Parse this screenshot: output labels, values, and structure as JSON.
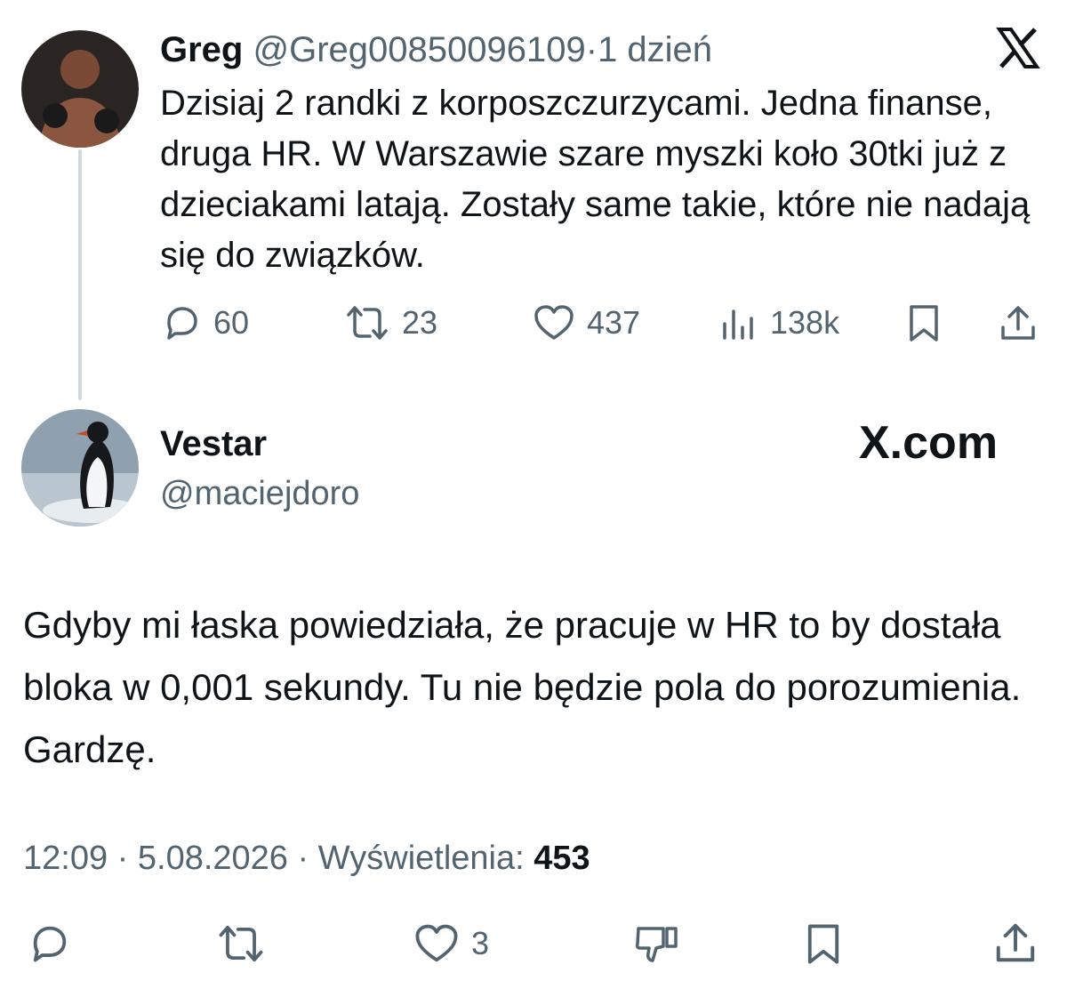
{
  "original_tweet": {
    "name": "Greg",
    "handle": "@Greg00850096109",
    "separator": "·",
    "time": "1 dzień",
    "text": "Dzisiaj 2 randki z korposzczurzycami. Jedna finanse, druga HR. W Warszawie szare myszki koło 30tki już z dzieciakami latają. Zostały same takie, które nie nadają się do związków.",
    "actions": {
      "replies": "60",
      "reposts": "23",
      "likes": "437",
      "views": "138k"
    }
  },
  "watermark": "X.com",
  "reply_tweet": {
    "name": "Vestar",
    "handle": "@maciejdoro",
    "text": "Gdyby mi łaska powiedziała, że pracuje w HR to by dostała bloka w 0,001 sekundy. Tu nie będzie pola do porozumienia. Gardzę.",
    "time": "12:09",
    "date": "5.08.2026",
    "views_label": "Wyświetlenia:",
    "views_count": "453",
    "actions": {
      "likes": "3"
    }
  },
  "icons": [
    "x-logo-icon",
    "reply-icon",
    "repost-icon",
    "like-icon",
    "views-icon",
    "bookmark-icon",
    "share-icon",
    "dislike-icon"
  ],
  "colors": {
    "text": "#0f1419",
    "secondary": "#536471",
    "thread_line": "#cfd9de"
  }
}
